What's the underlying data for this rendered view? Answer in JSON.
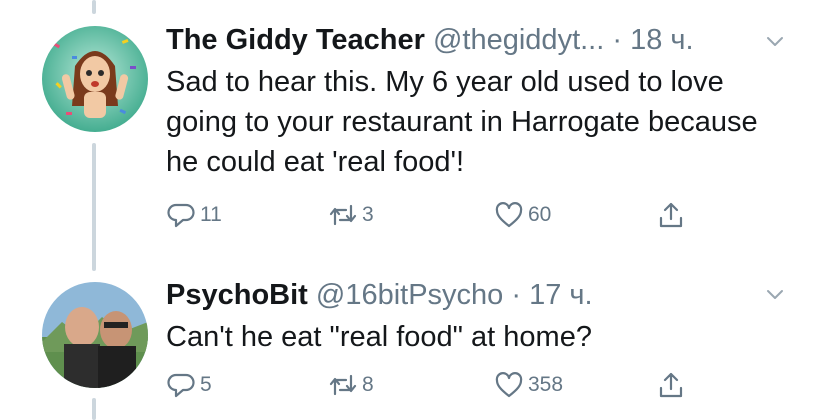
{
  "colors": {
    "secondary": "#657786",
    "text": "#14171a",
    "thread_line": "#ccd6dd"
  },
  "tweets": [
    {
      "name": "The Giddy Teacher",
      "handle": "@thegiddyt...",
      "time": "· 18 ч.",
      "text": "Sad to hear this. My 6 year old used to love going to your restaurant in Harrogate because he could eat 'real food'!",
      "reply_count": "11",
      "retweet_count": "3",
      "like_count": "60"
    },
    {
      "name": "PsychoBit",
      "handle": "@16bitPsycho",
      "time": "· 17 ч.",
      "text": "Can't he eat \"real food\" at home?",
      "reply_count": "5",
      "retweet_count": "8",
      "like_count": "358"
    }
  ],
  "icons": {
    "reply": "reply-icon",
    "retweet": "retweet-icon",
    "like": "heart-icon",
    "share": "share-icon",
    "more": "chevron-down-icon"
  }
}
